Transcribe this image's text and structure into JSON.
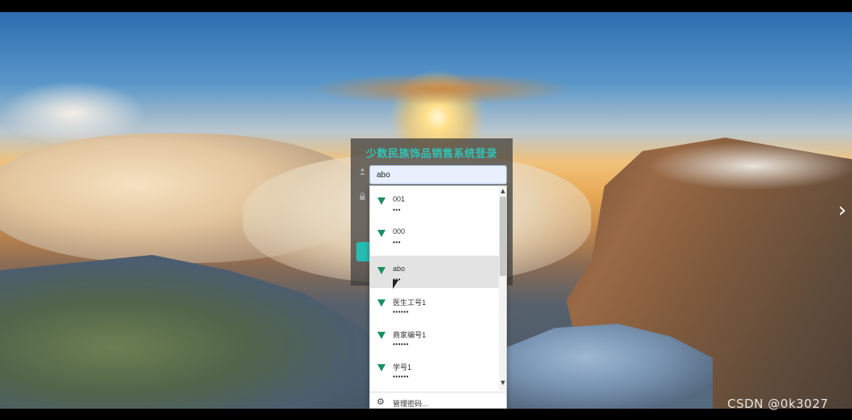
{
  "login": {
    "title": "少数民族饰品销售系统登录",
    "username_value": "abo"
  },
  "dropdown": {
    "items": [
      {
        "user": "001",
        "pass": "•••"
      },
      {
        "user": "000",
        "pass": "•••"
      },
      {
        "user": "abo",
        "pass": "•••",
        "selected": true
      },
      {
        "user": "医生工号1",
        "pass": "••••••"
      },
      {
        "user": "商家编号1",
        "pass": "••••••"
      },
      {
        "user": "学号1",
        "pass": "••••••"
      }
    ],
    "manage_label": "管理密码..."
  },
  "carousel": {
    "next_glyph": "›"
  },
  "watermark": {
    "text": "CSDN @0k3027"
  },
  "icons": {
    "user": "user-icon",
    "lock": "lock-icon",
    "key": "key-icon",
    "gear": "gear-icon"
  },
  "colors": {
    "title": "#2fc3b6",
    "accent_button": "#26bcb2",
    "key_icon": "#1b8f63"
  }
}
